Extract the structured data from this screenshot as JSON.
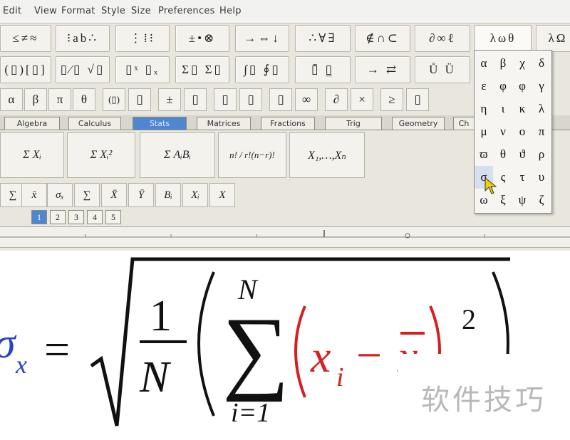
{
  "menu": [
    "Edit",
    "View",
    "Format",
    "Style",
    "Size",
    "Preferences",
    "Help"
  ],
  "palette_row1": [
    {
      "name": "relations-palette-button",
      "label": "≤≠≈"
    },
    {
      "name": "spaces-palette-button",
      "label": "⁝ab∴"
    },
    {
      "name": "embellishments-palette-button",
      "label": "⋮⁞⁝"
    },
    {
      "name": "operators-palette-button",
      "label": "±•⊗"
    },
    {
      "name": "arrows-palette-button",
      "label": "→⇔↓"
    },
    {
      "name": "logic-palette-button",
      "label": "∴∀∃"
    },
    {
      "name": "sets-palette-button",
      "label": "∉∩⊂"
    },
    {
      "name": "misc-palette-button",
      "label": "∂∞ℓ"
    },
    {
      "name": "greek-lower-palette-button",
      "label": "λωθ"
    },
    {
      "name": "greek-upper-palette-button",
      "label": "λΩ"
    }
  ],
  "palette_row2": [
    {
      "name": "fences-palette-button",
      "label": "(▯)[▯]"
    },
    {
      "name": "fractions-radicals-palette-button",
      "label": "▯⁄▯ √▯"
    },
    {
      "name": "subscripts-palette-button",
      "label": "▯ˣ ▯ₓ"
    },
    {
      "name": "summation-palette-button",
      "label": "Σ▯ Σ▯"
    },
    {
      "name": "integrals-palette-button",
      "label": "∫▯ ∮▯"
    },
    {
      "name": "underbars-palette-button",
      "label": "▯̄ ▯̲"
    },
    {
      "name": "labeled-arrows-palette-button",
      "label": "→ ⇄"
    },
    {
      "name": "products-palette-button",
      "label": "Ů Ü"
    }
  ],
  "symbol_row": [
    "α",
    "β",
    "π",
    "θ",
    "(▯)",
    "▯",
    "±",
    "▯",
    "▯",
    "▯",
    "▯",
    "∞",
    "∂",
    "×",
    "≥",
    "▯"
  ],
  "tabs": [
    "Algebra",
    "Calculus",
    "Stats",
    "Matrices",
    "Fractions",
    "Trig",
    "Geometry",
    "Ch"
  ],
  "active_tab": "Stats",
  "template_row": [
    {
      "name": "sum-xi-template",
      "label": "Σ Xᵢ"
    },
    {
      "name": "sum-xi-squared-template",
      "label": "Σ Xᵢ²"
    },
    {
      "name": "sum-aibi-template",
      "label": "Σ AᵢBᵢ"
    },
    {
      "name": "combination-template",
      "label": "n! / r!(n−r)!"
    },
    {
      "name": "sequence-template",
      "label": "X₁,…,Xₙ"
    }
  ],
  "small_templates": [
    "∑",
    "x̄",
    "σₓ",
    "∑",
    "X̄",
    "Ȳ",
    "Bᵢ",
    "Xᵢ",
    "X"
  ],
  "nav_tabs": [
    "1",
    "2",
    "3",
    "4",
    "5"
  ],
  "greek_palette": [
    [
      "α",
      "β",
      "χ",
      "δ"
    ],
    [
      "ε",
      "φ",
      "φ",
      "γ"
    ],
    [
      "η",
      "ι",
      "κ",
      "λ"
    ],
    [
      "μ",
      "ν",
      "ο",
      "π"
    ],
    [
      "ϖ",
      "θ",
      "ϑ",
      "ρ"
    ],
    [
      "σ",
      "ς",
      "τ",
      "υ"
    ],
    [
      "ω",
      "ξ",
      "ψ",
      "ζ"
    ]
  ],
  "equation": {
    "lhs_symbol": "σ",
    "lhs_sub": "x",
    "equals": "=",
    "frac_num": "1",
    "frac_den": "N",
    "sum_upper": "N",
    "sum_lower": "i=1",
    "term_x": "x",
    "term_sub": "i",
    "minus": "−",
    "term_xbar": "x",
    "exponent": "2",
    "colors": {
      "lhs": "#2742c9",
      "term": "#d42020",
      "main": "#111111"
    }
  },
  "watermark": "软件技巧"
}
